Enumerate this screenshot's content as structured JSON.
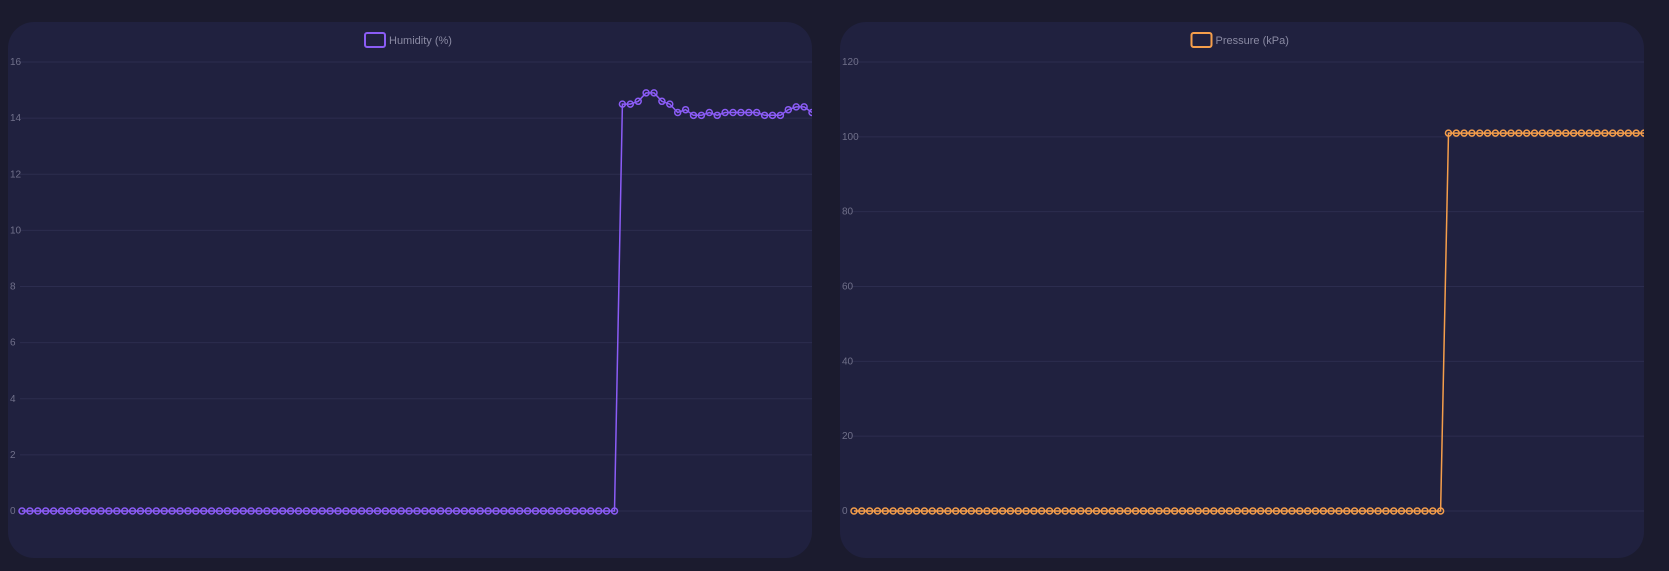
{
  "chart_data": [
    {
      "type": "line",
      "series": [
        {
          "name": "Humidity (%)",
          "color": "#8b5cf6",
          "values": [
            0,
            0,
            0,
            0,
            0,
            0,
            0,
            0,
            0,
            0,
            0,
            0,
            0,
            0,
            0,
            0,
            0,
            0,
            0,
            0,
            0,
            0,
            0,
            0,
            0,
            0,
            0,
            0,
            0,
            0,
            0,
            0,
            0,
            0,
            0,
            0,
            0,
            0,
            0,
            0,
            0,
            0,
            0,
            0,
            0,
            0,
            0,
            0,
            0,
            0,
            0,
            0,
            0,
            0,
            0,
            0,
            0,
            0,
            0,
            0,
            0,
            0,
            0,
            0,
            0,
            0,
            0,
            0,
            0,
            0,
            0,
            0,
            0,
            0,
            0,
            0,
            14.5,
            14.5,
            14.6,
            14.9,
            14.9,
            14.6,
            14.5,
            14.2,
            14.3,
            14.1,
            14.1,
            14.2,
            14.1,
            14.2,
            14.2,
            14.2,
            14.2,
            14.2,
            14.1,
            14.1,
            14.1,
            14.3,
            14.4,
            14.4,
            14.2
          ]
        }
      ],
      "yticks": [
        "0",
        "2",
        "4",
        "6",
        "8",
        "10",
        "12",
        "14",
        "16"
      ],
      "ylim": [
        0,
        16
      ],
      "grid": true,
      "legend_position": "top-center"
    },
    {
      "type": "line",
      "series": [
        {
          "name": "Pressure (kPa)",
          "color": "#f59e4b",
          "values": [
            0,
            0,
            0,
            0,
            0,
            0,
            0,
            0,
            0,
            0,
            0,
            0,
            0,
            0,
            0,
            0,
            0,
            0,
            0,
            0,
            0,
            0,
            0,
            0,
            0,
            0,
            0,
            0,
            0,
            0,
            0,
            0,
            0,
            0,
            0,
            0,
            0,
            0,
            0,
            0,
            0,
            0,
            0,
            0,
            0,
            0,
            0,
            0,
            0,
            0,
            0,
            0,
            0,
            0,
            0,
            0,
            0,
            0,
            0,
            0,
            0,
            0,
            0,
            0,
            0,
            0,
            0,
            0,
            0,
            0,
            0,
            0,
            0,
            0,
            0,
            0,
            101,
            101,
            101,
            101,
            101,
            101,
            101,
            101,
            101,
            101,
            101,
            101,
            101,
            101,
            101,
            101,
            101,
            101,
            101,
            101,
            101,
            101,
            101,
            101,
            101,
            101
          ]
        }
      ],
      "yticks": [
        "0",
        "20",
        "40",
        "60",
        "80",
        "100",
        "120"
      ],
      "ylim": [
        0,
        120
      ],
      "grid": true,
      "legend_position": "top-center"
    }
  ]
}
